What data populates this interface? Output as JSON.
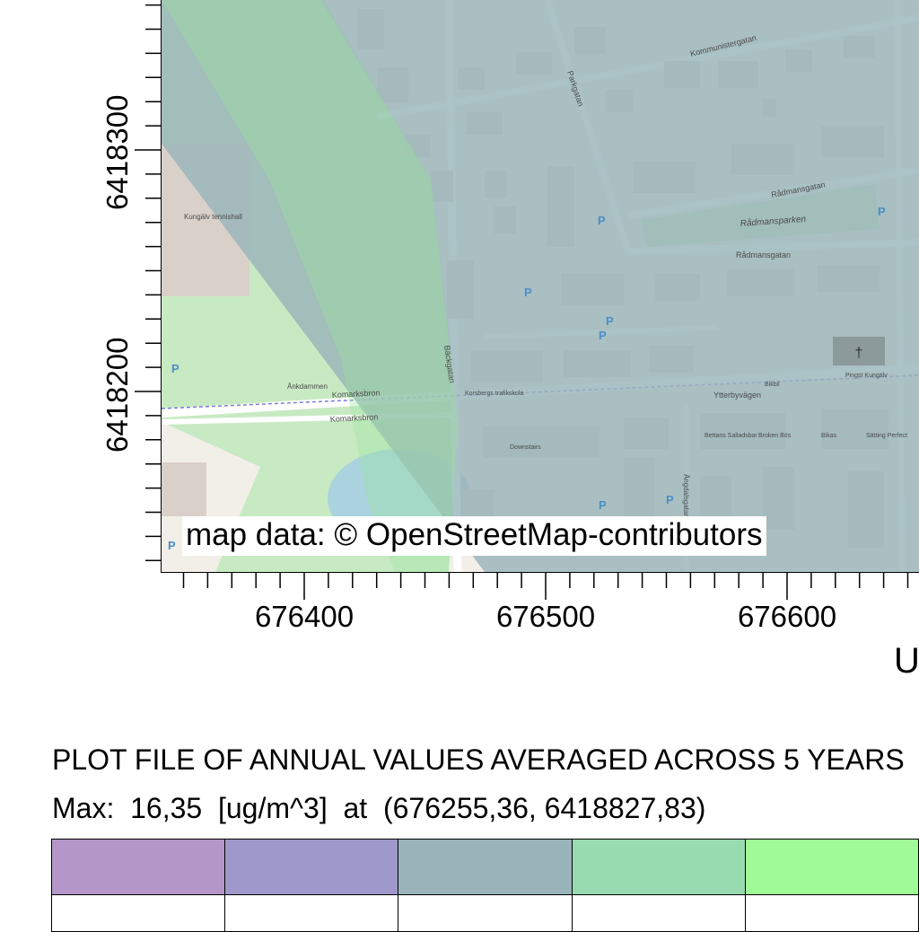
{
  "map": {
    "attribution": "map data: © OpenStreetMap-contributors",
    "street_labels": [
      {
        "text": "Kommunistergatan"
      },
      {
        "text": "Parkgatan"
      },
      {
        "text": "Rådmansgatan"
      },
      {
        "text": "Rådmansparken"
      },
      {
        "text": "Rådmansgatan"
      },
      {
        "text": "Bäckgatan"
      },
      {
        "text": "Ytterbyvägen"
      },
      {
        "text": "Komarksbron"
      },
      {
        "text": "Komarksbron"
      },
      {
        "text": "Änkdammen"
      },
      {
        "text": "Kungälv tennishall"
      },
      {
        "text": "Korsbergs trafikskola"
      },
      {
        "text": "Downstairs"
      },
      {
        "text": "Bettans Salladsbar"
      },
      {
        "text": "Broken Bös"
      },
      {
        "text": "Bikbil"
      },
      {
        "text": "Pingst Kungälv"
      },
      {
        "text": "Sätting Perfect"
      },
      {
        "text": "Bikas"
      },
      {
        "text": "Ängdalsgatan"
      }
    ],
    "parking_symbol": "P",
    "overlay_colors": {
      "plume_gray": "#98b4ba",
      "plume_green": "#9be69a",
      "base": "#f2efe9"
    }
  },
  "axes": {
    "y_ticks": [
      {
        "label": "6418300",
        "value": 6418300
      },
      {
        "label": "6418200",
        "value": 6418200
      }
    ],
    "x_ticks": [
      {
        "label": "676400",
        "value": 676400
      },
      {
        "label": "676500",
        "value": 676500
      },
      {
        "label": "676600",
        "value": 676600
      }
    ],
    "x_unit_label": "U"
  },
  "plot": {
    "title": "PLOT FILE OF ANNUAL VALUES AVERAGED ACROSS 5 YEARS",
    "max_line": "Max:  16,35  [ug/m^3]  at  (676255,36, 6418827,83)"
  },
  "legend": {
    "colors": [
      "#b497c8",
      "#9f98cb",
      "#98b4ba",
      "#98dbb0",
      "#a0fb96"
    ]
  }
}
